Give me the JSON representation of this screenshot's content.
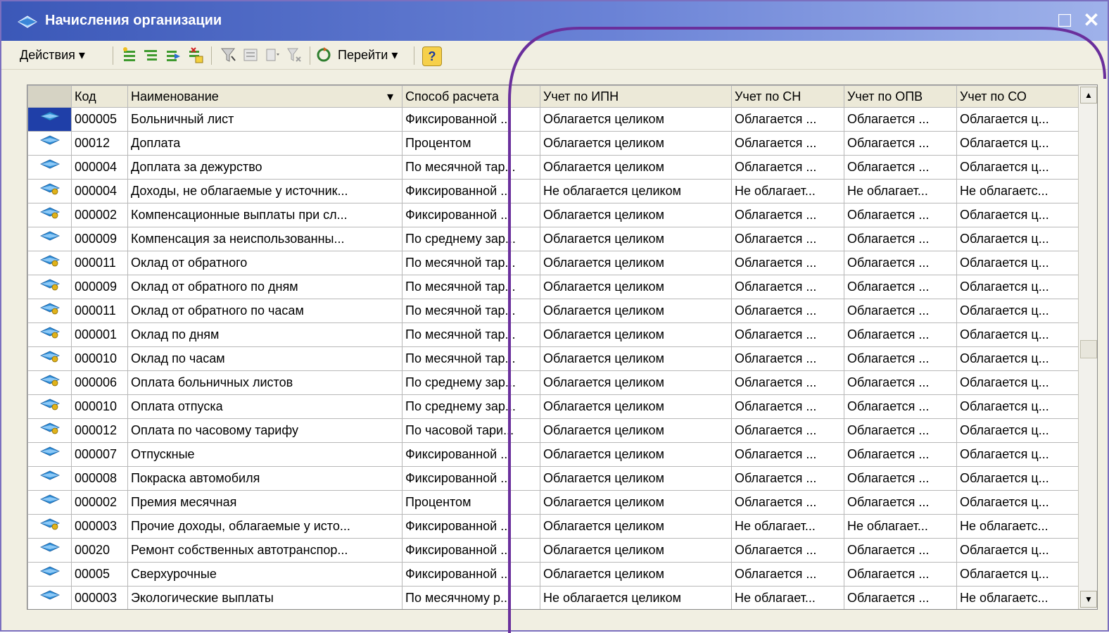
{
  "window": {
    "title": "Начисления организации",
    "minimize_label": "_",
    "maximize_label": "□",
    "close_label": "✕"
  },
  "toolbar": {
    "actions_label": "Действия",
    "goto_label": "Перейти",
    "help_label": "?",
    "dropdown_glyph": "▾"
  },
  "table": {
    "headers": [
      "Код",
      "Наименование",
      "Способ расчета",
      "Учет по ИПН",
      "Учет по СН",
      "Учет по ОПВ",
      "Учет по СО"
    ],
    "sort_glyph": "▾",
    "rows": [
      {
        "icon": "diamond",
        "code": "000005",
        "name": "Больничный лист",
        "method": "Фиксированной ...",
        "ipn": "Облагается целиком",
        "sn": "Облагается ...",
        "opv": "Облагается ...",
        "so": "Облагается ц..."
      },
      {
        "icon": "diamond",
        "code": "00012",
        "name": "Доплата",
        "method": "Процентом",
        "ipn": "Облагается целиком",
        "sn": "Облагается ...",
        "opv": "Облагается ...",
        "so": "Облагается ц..."
      },
      {
        "icon": "diamond",
        "code": "000004",
        "name": "Доплата за дежурство",
        "method": "По месячной тар...",
        "ipn": "Облагается целиком",
        "sn": "Облагается ...",
        "opv": "Облагается ...",
        "so": "Облагается ц..."
      },
      {
        "icon": "diamond-dot",
        "code": "000004",
        "name": "Доходы, не облагаемые у источник...",
        "method": "Фиксированной ...",
        "ipn": "Не облагается целиком",
        "sn": "Не облагает...",
        "opv": "Не облагает...",
        "so": "Не облагаетс..."
      },
      {
        "icon": "diamond-dot",
        "code": "000002",
        "name": "Компенсационные выплаты при сл...",
        "method": "Фиксированной ...",
        "ipn": "Облагается целиком",
        "sn": "Облагается ...",
        "opv": "Облагается ...",
        "so": "Облагается ц..."
      },
      {
        "icon": "diamond",
        "code": "000009",
        "name": "Компенсация за неиспользованны...",
        "method": "По среднему зар...",
        "ipn": "Облагается целиком",
        "sn": "Облагается ...",
        "opv": "Облагается ...",
        "so": "Облагается ц..."
      },
      {
        "icon": "diamond-dot",
        "code": "000011",
        "name": "Оклад от обратного",
        "method": "По месячной тар...",
        "ipn": "Облагается целиком",
        "sn": "Облагается ...",
        "opv": "Облагается ...",
        "so": "Облагается ц..."
      },
      {
        "icon": "diamond-dot",
        "code": "000009",
        "name": "Оклад от обратного по дням",
        "method": "По месячной тар...",
        "ipn": "Облагается целиком",
        "sn": "Облагается ...",
        "opv": "Облагается ...",
        "so": "Облагается ц..."
      },
      {
        "icon": "diamond-dot",
        "code": "000011",
        "name": "Оклад от обратного по часам",
        "method": "По месячной тар...",
        "ipn": "Облагается целиком",
        "sn": "Облагается ...",
        "opv": "Облагается ...",
        "so": "Облагается ц..."
      },
      {
        "icon": "diamond-dot",
        "code": "000001",
        "name": "Оклад по дням",
        "method": "По месячной тар...",
        "ipn": "Облагается целиком",
        "sn": "Облагается ...",
        "opv": "Облагается ...",
        "so": "Облагается ц..."
      },
      {
        "icon": "diamond-dot",
        "code": "000010",
        "name": "Оклад по часам",
        "method": "По месячной тар...",
        "ipn": "Облагается целиком",
        "sn": "Облагается ...",
        "opv": "Облагается ...",
        "so": "Облагается ц..."
      },
      {
        "icon": "diamond-dot",
        "code": "000006",
        "name": "Оплата больничных листов",
        "method": "По среднему зар...",
        "ipn": "Облагается целиком",
        "sn": "Облагается ...",
        "opv": "Облагается ...",
        "so": "Облагается ц..."
      },
      {
        "icon": "diamond-dot",
        "code": "000010",
        "name": "Оплата отпуска",
        "method": "По среднему зар...",
        "ipn": "Облагается целиком",
        "sn": "Облагается ...",
        "opv": "Облагается ...",
        "so": "Облагается ц..."
      },
      {
        "icon": "diamond-dot",
        "code": "000012",
        "name": "Оплата по часовому тарифу",
        "method": "По часовой тари...",
        "ipn": "Облагается целиком",
        "sn": "Облагается ...",
        "opv": "Облагается ...",
        "so": "Облагается ц..."
      },
      {
        "icon": "diamond",
        "code": "000007",
        "name": "Отпускные",
        "method": "Фиксированной ...",
        "ipn": "Облагается целиком",
        "sn": "Облагается ...",
        "opv": "Облагается ...",
        "so": "Облагается ц..."
      },
      {
        "icon": "diamond",
        "code": "000008",
        "name": "Покраска автомобиля",
        "method": "Фиксированной ...",
        "ipn": "Облагается целиком",
        "sn": "Облагается ...",
        "opv": "Облагается ...",
        "so": "Облагается ц..."
      },
      {
        "icon": "diamond",
        "code": "000002",
        "name": "Премия месячная",
        "method": "Процентом",
        "ipn": "Облагается целиком",
        "sn": "Облагается ...",
        "opv": "Облагается ...",
        "so": "Облагается ц..."
      },
      {
        "icon": "diamond-dot",
        "code": "000003",
        "name": "Прочие доходы, облагаемые у исто...",
        "method": "Фиксированной ...",
        "ipn": "Облагается целиком",
        "sn": "Не облагает...",
        "opv": "Не облагает...",
        "so": "Не облагаетс..."
      },
      {
        "icon": "diamond",
        "code": "00020",
        "name": "Ремонт собственных автотранспор...",
        "method": "Фиксированной ...",
        "ipn": "Облагается целиком",
        "sn": "Облагается ...",
        "opv": "Облагается ...",
        "so": "Облагается ц..."
      },
      {
        "icon": "diamond",
        "code": "00005",
        "name": "Сверхурочные",
        "method": "Фиксированной ...",
        "ipn": "Облагается целиком",
        "sn": "Облагается ...",
        "opv": "Облагается ...",
        "so": "Облагается ц..."
      },
      {
        "icon": "diamond",
        "code": "000003",
        "name": "Экологические выплаты",
        "method": "По месячному р...",
        "ipn": "Не облагается целиком",
        "sn": "Не облагает...",
        "opv": "Облагается ...",
        "so": "Не облагаетс..."
      }
    ]
  },
  "colors": {
    "title_bar": "#3b58b8",
    "annotation_line": "#6a2f9c",
    "selection": "#1f3fa8",
    "row_icon": "#2d8fd8",
    "row_icon_dot": "#e0b21a"
  }
}
